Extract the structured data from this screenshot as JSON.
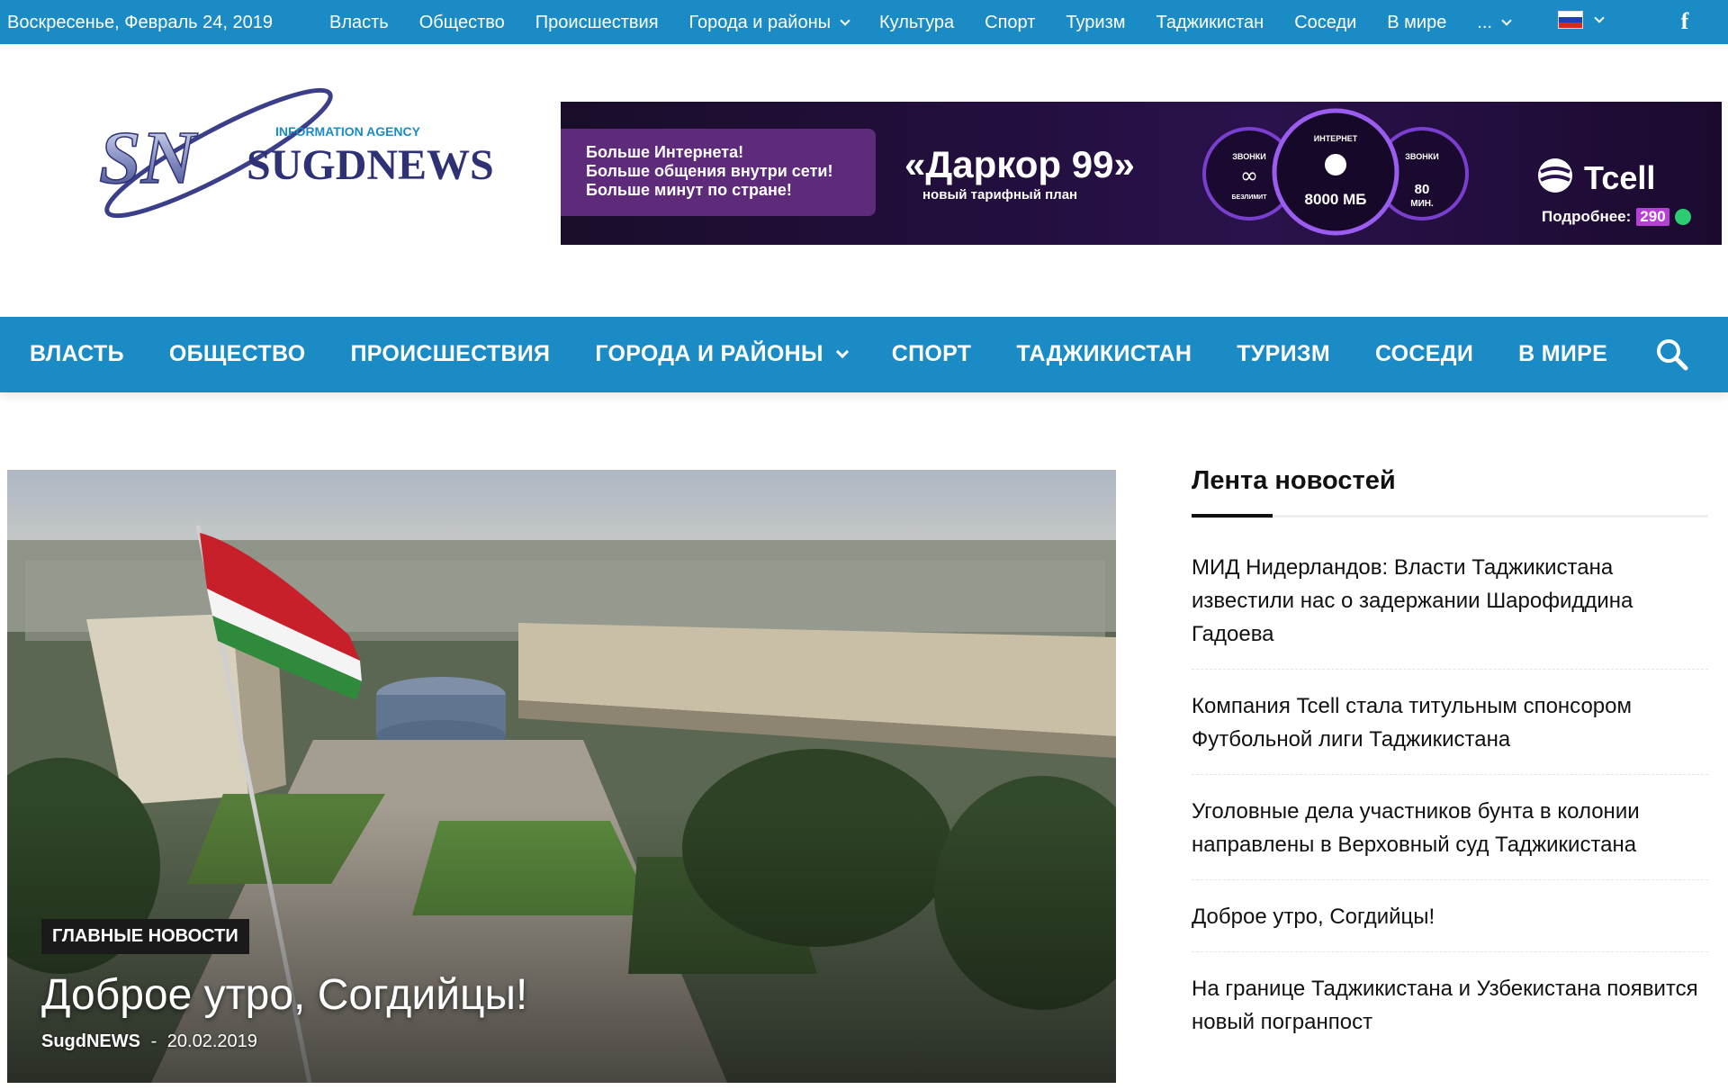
{
  "topbar": {
    "date": "Воскресенье, Февраль 24, 2019",
    "nav": [
      {
        "label": "Власть"
      },
      {
        "label": "Общество"
      },
      {
        "label": "Происшествия"
      },
      {
        "label": "Города и районы",
        "dropdown": true
      },
      {
        "label": "Культура"
      },
      {
        "label": "Спорт"
      },
      {
        "label": "Туризм"
      },
      {
        "label": "Таджикистан"
      },
      {
        "label": "Соседи"
      },
      {
        "label": "В мире"
      },
      {
        "label": "...",
        "dropdown": true
      }
    ],
    "language_icon": "russian-flag-icon",
    "social_icon": "facebook-icon",
    "facebook_glyph": "f"
  },
  "logo": {
    "mark": "SN",
    "agency": "INFORMATION AGENCY",
    "name": "SUGDNEWS"
  },
  "banner": {
    "promo_lines": [
      "Больше Интернета!",
      "Больше общения внутри сети!",
      "Больше минут по стране!"
    ],
    "title": "«Даркор 99»",
    "subtitle": "новый тарифный план",
    "gauges": [
      {
        "top": "ЗВОНКИ",
        "value": "∞",
        "bottom": "БЕЗЛИМИТ"
      },
      {
        "top": "ИНТЕРНЕТ",
        "value": "8000 МБ",
        "bottom": ""
      },
      {
        "top": "ЗВОНКИ",
        "value": "80",
        "bottom": "МИН."
      }
    ],
    "brand": "Tcell",
    "more_label": "Подробнее:",
    "more_number": "290"
  },
  "mainnav": {
    "items": [
      {
        "label": "ВЛАСТЬ"
      },
      {
        "label": "ОБЩЕСТВО"
      },
      {
        "label": "ПРОИСШЕСТВИЯ"
      },
      {
        "label": "ГОРОДА И РАЙОНЫ",
        "dropdown": true
      },
      {
        "label": "СПОРТ"
      },
      {
        "label": "ТАДЖИКИСТАН"
      },
      {
        "label": "ТУРИЗМ"
      },
      {
        "label": "СОСЕДИ"
      },
      {
        "label": "В МИРЕ"
      }
    ],
    "search_icon": "search-icon"
  },
  "hero": {
    "category": "ГЛАВНЫЕ НОВОСТИ",
    "title": "Доброе утро, Согдийцы!",
    "author": "SugdNEWS",
    "separator": "-",
    "date": "20.02.2019"
  },
  "sidebar": {
    "heading": "Лента новостей",
    "items": [
      "МИД Нидерландов: Власти Таджикистана известили нас о задержании Шарофиддина Гадоева",
      "Компания Tcell стала титульным спонсором Футбольной лиги Таджикистана",
      "Уголовные дела участников бунта в колонии направлены в Верховный суд Таджикистана",
      "Доброе утро, Согдийцы!",
      "На границе Таджикистана и Узбекистана появится новый погранпост"
    ]
  },
  "colors": {
    "brand_blue": "#1b8bc5",
    "banner_purple": "#2a124c",
    "text_dark": "#111111"
  }
}
